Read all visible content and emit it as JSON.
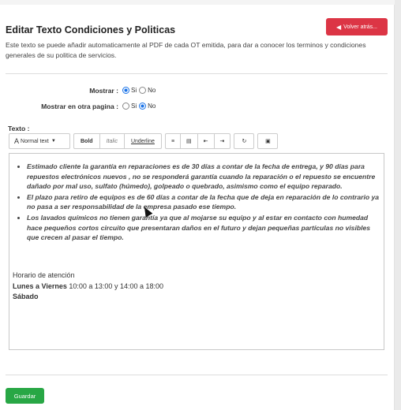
{
  "page": {
    "title": "Editar Texto Condiciones y Politicas",
    "back_label": "Volver atrás...",
    "description": "Este texto se puede añadir automaticamente al PDF de cada OT emitida, para dar a conocer los terminos y condiciones generales de su politica de servicios."
  },
  "form": {
    "mostrar_label": "Mostrar :",
    "mostrar_yes": "Si",
    "mostrar_no": "No",
    "mostrar_value": "Si",
    "otra_pagina_label": "Mostrar en otra pagina :",
    "otra_yes": "Si",
    "otra_no": "No",
    "otra_value": "No",
    "texto_label": "Texto :"
  },
  "toolbar": {
    "format_label": "Normal text",
    "bold": "Bold",
    "italic": "Italic",
    "underline": "Underline"
  },
  "editor": {
    "bullets": [
      "Estimado cliente la garantía en reparaciones es de 30 días a contar de la fecha de entrega, y 90 días para repuestos electrónicos  nuevos , no se responderá garantía cuando la reparación o el repuesto se encuentre dañado por mal uso, sulfato (húmedo), golpeado o quebrado, asimismo como el equipo reparado.",
      "El plazo para retiro de equipos es de 60 días a contar de la fecha que de deja en reparación de lo contrario ya no pasa a ser responsabilidad de la empresa pasado ese tiempo.",
      "Los lavados químicos no tienen garantía ya que al mojarse su equipo y al estar en contacto con humedad hace pequeños cortos circuito que presentaran daños en el futuro y dejan pequeñas partículas no visibles que crecen al pasar el tiempo."
    ],
    "hours_title": "Horario de atención",
    "weekday_label": "Lunes a Viernes",
    "weekday_hours": "10:00 a 13:00 y 14:00 a 18:00",
    "saturday_label": "Sábado"
  },
  "actions": {
    "save_label": "Guardar"
  },
  "colors": {
    "danger": "#dc3545",
    "success": "#28a745",
    "radio_on": "#1a73e8"
  }
}
